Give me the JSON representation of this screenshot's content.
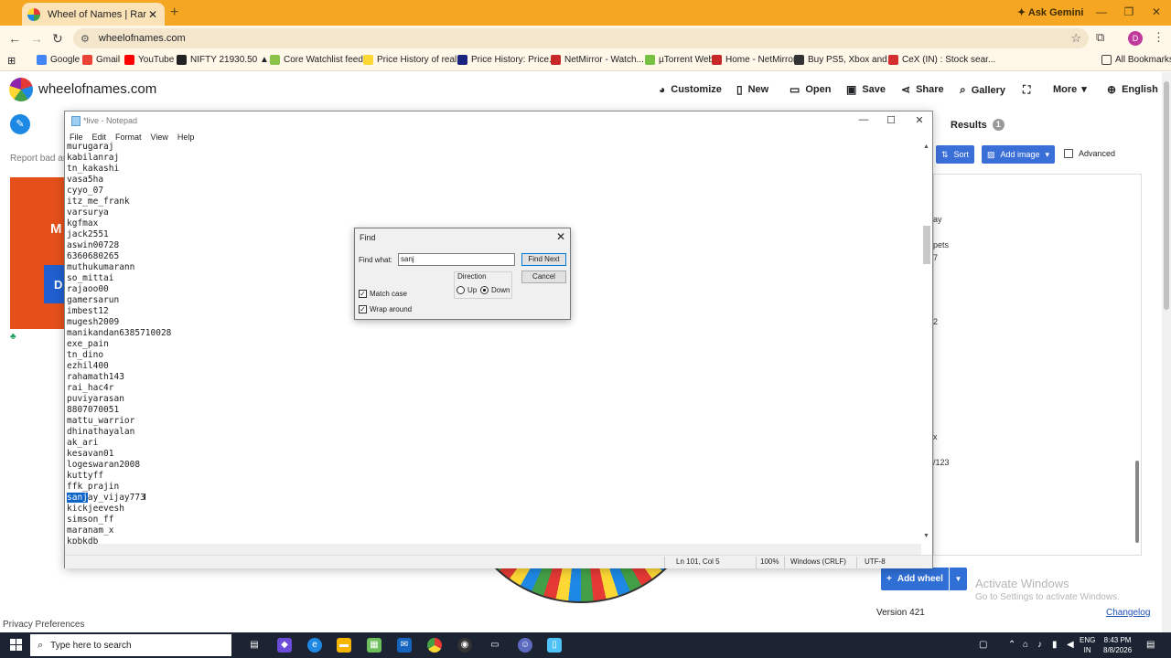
{
  "browser": {
    "tab_title": "Wheel of Names | Random nam",
    "new_tab": "+",
    "ask_gemini": "Ask Gemini",
    "url": "wheelofnames.com",
    "profile_initial": "D",
    "bookmarks": [
      "Google",
      "Gmail",
      "YouTube",
      "NIFTY 21930.50 ▲...",
      "Core Watchlist feed...",
      "Price History of real...",
      "Price History: Price...",
      "NetMirror - Watch...",
      "µTorrent Web",
      "Home - NetMirror",
      "Buy PS5, Xbox and...",
      "CeX (IN) : Stock sear...",
      "All Bookmarks"
    ]
  },
  "site": {
    "name": "wheelofnames.com",
    "menu": [
      "Customize",
      "New",
      "Open",
      "Save",
      "Share",
      "Gallery",
      "More",
      "English"
    ],
    "report_bad": "Report bad ar",
    "banner_letter1": "M",
    "banner_letter2": "D",
    "privacy": "Privacy Preferences",
    "results_label": "Results",
    "results_count": "1",
    "sort_label": "Sort",
    "add_image_label": "Add image",
    "advanced_label": "Advanced",
    "entry_fragments": [
      "ay",
      "pets",
      "7",
      "2",
      "x",
      "/123"
    ],
    "add_wheel_label": "Add wheel",
    "version": "Version 421",
    "changelog": "Changelog",
    "activate_title": "Activate Windows",
    "activate_sub": "Go to Settings to activate Windows."
  },
  "notepad": {
    "title": "*live - Notepad",
    "menu": [
      "File",
      "Edit",
      "Format",
      "View",
      "Help"
    ],
    "lines": [
      "murugaraj",
      "kabilanraj",
      "tn_kakashi",
      "vasa5ha",
      "cyyo_07",
      "itz_me_frank",
      "varsurya",
      "kgfmax",
      "jack2551",
      "aswin00728",
      "6360680265",
      "muthukumarann",
      "so_mittai",
      "rajaoo00",
      "gamersarun",
      "imbest12",
      "mugesh2009",
      "manikandan6385710028",
      "exe_pain",
      "tn_dino",
      "ezhil400",
      "rahamath143",
      "rai_hac4r",
      "puviyarasan",
      "8807070051",
      "mattu_warrior",
      "dhinathayalan",
      "ak_ari",
      "kesavan01",
      "logeswaran2008",
      "kuttyff",
      "ffk_prajin"
    ],
    "selected_part": "sanj",
    "selected_rest": "ay_vijay773",
    "after_lines": [
      "kickjeevesh",
      "simson_ff",
      "maranam_x",
      "kpbkdb"
    ],
    "status_pos": "Ln 101, Col 5",
    "status_zoom": "100%",
    "status_eol": "Windows (CRLF)",
    "status_enc": "UTF-8"
  },
  "find": {
    "title": "Find",
    "find_what_label": "Find what:",
    "find_what_value": "sanj",
    "find_next": "Find Next",
    "cancel": "Cancel",
    "direction": "Direction",
    "up": "Up",
    "down": "Down",
    "match_case": "Match case",
    "wrap_around": "Wrap around"
  },
  "taskbar": {
    "search_placeholder": "Type here to search",
    "lang1": "ENG",
    "lang2": "IN",
    "time": "8:43 PM",
    "date": "8/8/2026"
  }
}
